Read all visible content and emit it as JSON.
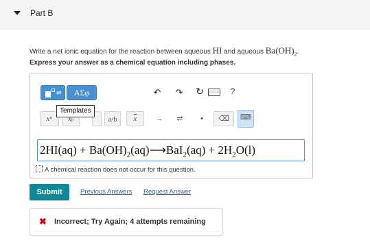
{
  "part": {
    "title": "Part B"
  },
  "question": {
    "prefix": "Write a net ionic equation for the reaction between aqueous ",
    "reactant1": "HI",
    "middle": " and aqueous ",
    "reactant2_main": "Ba(OH)",
    "reactant2_sub": "2",
    "suffix": "."
  },
  "instruction": "Express your answer as a chemical equation including phases.",
  "toolbar": {
    "greek_label": "ΑΣφ",
    "tooltip": "Templates",
    "help_label": "?",
    "sup_label": "xᵃ",
    "sub_label": "xᵦ",
    "frac_label": "a/b",
    "xbar_label": "x",
    "arrow_label": "→",
    "eq_label": "⇌",
    "dot_label": "•",
    "del_label": "⌫"
  },
  "answer": {
    "p1": "2HI(aq) + Ba(OH)",
    "s1": "2",
    "p2": "(aq)⟶BaI",
    "s2": "2",
    "p3": "(aq) + 2H",
    "s3": "2",
    "p4": "O(l)"
  },
  "no_reaction_label": "A chemical reaction does not occur for this question.",
  "buttons": {
    "submit": "Submit",
    "previous_answers": "Previous Answers",
    "request_answer": "Request Answer"
  },
  "feedback": {
    "icon": "✖",
    "message": "Incorrect; Try Again; 4 attempts remaining"
  },
  "colors": {
    "accent": "#4a8fd1",
    "submit": "#12879a",
    "link": "#2565ae",
    "error": "#d0021b"
  }
}
